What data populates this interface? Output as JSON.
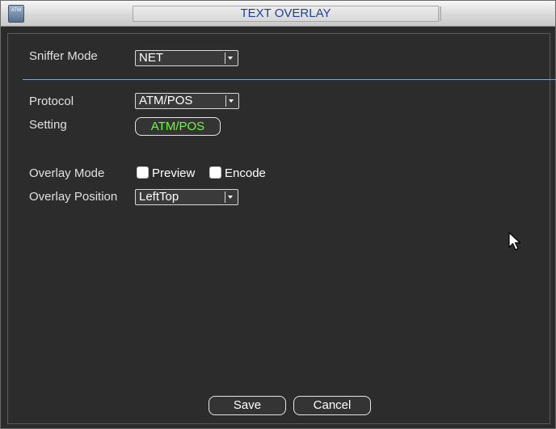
{
  "window": {
    "title": "TEXT OVERLAY",
    "icon": "atm-icon",
    "icon_text": "ATM"
  },
  "form": {
    "sniffer_mode": {
      "label": "Sniffer Mode",
      "value": "NET"
    },
    "protocol": {
      "label": "Protocol",
      "value": "ATM/POS"
    },
    "setting": {
      "label": "Setting",
      "button_label": "ATM/POS"
    },
    "overlay_mode": {
      "label": "Overlay Mode",
      "options": [
        {
          "label": "Preview",
          "checked": false
        },
        {
          "label": "Encode",
          "checked": false
        }
      ]
    },
    "overlay_position": {
      "label": "Overlay Position",
      "value": "LeftTop"
    }
  },
  "buttons": {
    "save": "Save",
    "cancel": "Cancel"
  },
  "colors": {
    "background": "#2c2c2c",
    "title_text": "#1f3fa0",
    "setting_button_text": "#66ff33",
    "divider": "#8aa6c4"
  }
}
